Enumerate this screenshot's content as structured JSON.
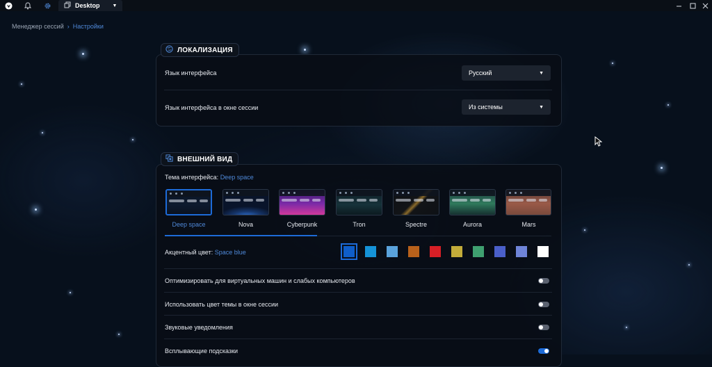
{
  "titlebar": {
    "tab_title": "Desktop",
    "icons": [
      "app-logo-icon",
      "bell-icon",
      "gear-icon",
      "copy-icon",
      "chevron-down-icon"
    ],
    "window_controls": [
      "minimize-icon",
      "maximize-icon",
      "close-icon"
    ]
  },
  "breadcrumb": {
    "items": [
      "Менеджер сессий",
      "Настройки"
    ]
  },
  "localization": {
    "heading": "ЛОКАЛИЗАЦИЯ",
    "icon": "globe-icon",
    "rows": [
      {
        "label": "Язык интерфейса",
        "value": "Русский"
      },
      {
        "label": "Язык интерфейса в окне сессии",
        "value": "Из системы"
      }
    ]
  },
  "appearance": {
    "heading": "ВНЕШНИЙ ВИД",
    "icon": "palette-icon",
    "theme_label": "Тема интерфейса:",
    "theme_value": "Deep space",
    "themes": [
      {
        "name": "Deep space",
        "selected": true
      },
      {
        "name": "Nova",
        "selected": false
      },
      {
        "name": "Cyberpunk",
        "selected": false
      },
      {
        "name": "Tron",
        "selected": false
      },
      {
        "name": "Spectre",
        "selected": false
      },
      {
        "name": "Aurora",
        "selected": false
      },
      {
        "name": "Mars",
        "selected": false
      }
    ],
    "accent_label": "Акцентный цвет:",
    "accent_value": "Space blue",
    "accent_colors": [
      "#0f5ec9",
      "#1593d8",
      "#5aa3dc",
      "#b8611b",
      "#d71f26",
      "#c3ac3a",
      "#3fa070",
      "#4a5fc9",
      "#6f84d8",
      "#ffffff"
    ],
    "accent_selected": 0,
    "toggles": [
      {
        "label": "Оптимизировать для виртуальных машин и слабых компьютеров",
        "on": false
      },
      {
        "label": "Использовать цвет темы в окне сессии",
        "on": false
      },
      {
        "label": "Звуковые уведомления",
        "on": false
      },
      {
        "label": "Всплывающие подсказки",
        "on": true
      }
    ]
  },
  "colors": {
    "accent": "#1d6bd8",
    "link": "#4f89d9",
    "background": "#07101c"
  }
}
